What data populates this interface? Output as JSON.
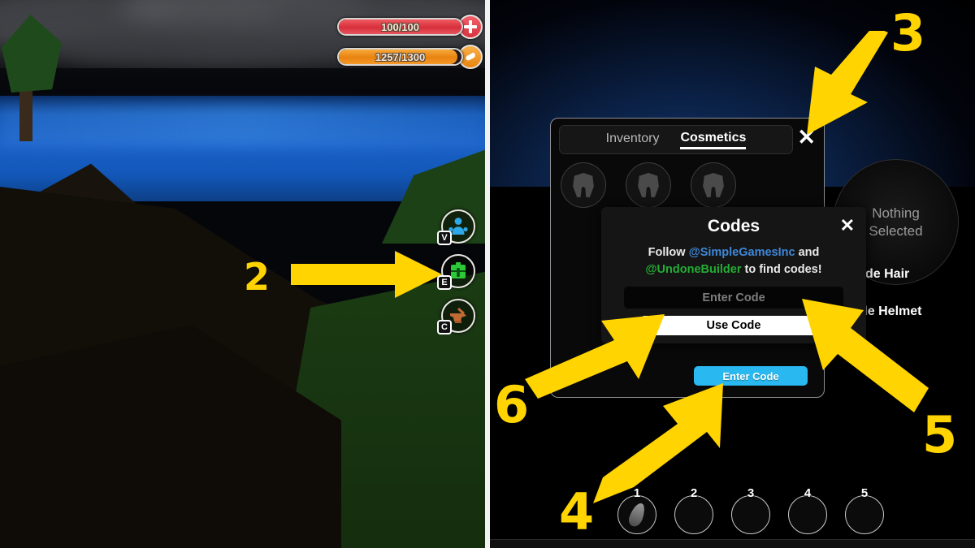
{
  "hud": {
    "health": {
      "label": "100/100",
      "current": 100,
      "max": 100,
      "percent": 100,
      "color": "#d6303c"
    },
    "stamina": {
      "label": "1257/1300",
      "current": 1257,
      "max": 1300,
      "percent": 96.7,
      "color": "#ea8410"
    },
    "add_health_icon": "plus-icon",
    "stamina_icon": "food-icon"
  },
  "side_buttons": [
    {
      "key": "V",
      "icon": "character-icon",
      "color": "#2fa8e8"
    },
    {
      "key": "E",
      "icon": "backpack-icon",
      "color": "#2bc937"
    },
    {
      "key": "C",
      "icon": "anvil-icon",
      "color": "#c26a33"
    }
  ],
  "inventory": {
    "tabs": [
      {
        "label": "Inventory",
        "active": false
      },
      {
        "label": "Cosmetics",
        "active": true
      }
    ],
    "close_label": "✕",
    "slots": [
      {
        "icon": "helmet-icon"
      },
      {
        "icon": "helmet-icon"
      },
      {
        "icon": "helmet-icon"
      }
    ],
    "enter_code_button": "Enter Code",
    "enter_code_color": "#29b8ef"
  },
  "preview": {
    "nothing_selected_line1": "Nothing",
    "nothing_selected_line2": "Selected",
    "options": [
      {
        "label": "Hide Hair"
      },
      {
        "label": "Hide Helmet"
      }
    ]
  },
  "codes_dialog": {
    "title": "Codes",
    "close_label": "✕",
    "follow_prefix": "Follow ",
    "handle_blue": "@SimpleGamesInc",
    "follow_middle": " and",
    "handle_green": "@UndoneBuilder",
    "follow_suffix": " to find codes!",
    "input_placeholder": "Enter Code",
    "input_value": "",
    "use_code_button": "Use Code",
    "blue_color": "#3f87d8",
    "green_color": "#23ad34"
  },
  "hotbar": {
    "slots": [
      {
        "number": "1",
        "filled": true
      },
      {
        "number": "2",
        "filled": false
      },
      {
        "number": "3",
        "filled": false
      },
      {
        "number": "4",
        "filled": false
      },
      {
        "number": "5",
        "filled": false
      }
    ]
  },
  "annotations": {
    "color": "#FFD400",
    "steps": [
      {
        "number": "2",
        "points_to": "inventory-side-button"
      },
      {
        "number": "3",
        "points_to": "cosmetics-tab"
      },
      {
        "number": "4",
        "points_to": "enter-code-button"
      },
      {
        "number": "5",
        "points_to": "code-input-field"
      },
      {
        "number": "6",
        "points_to": "use-code-button"
      }
    ]
  }
}
